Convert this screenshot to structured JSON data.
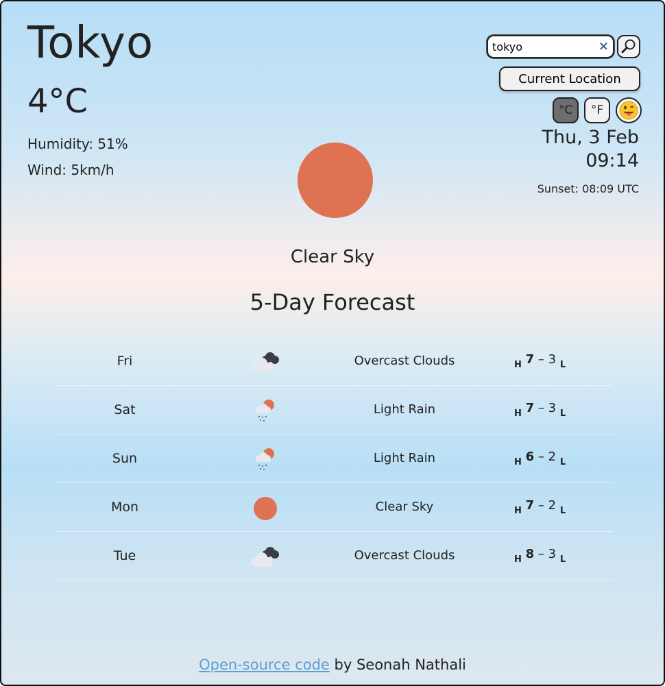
{
  "current": {
    "city": "Tokyo",
    "temperature": "4°C",
    "humidity": "Humidity: 51%",
    "wind": "Wind: 5km/h",
    "condition": "Clear Sky",
    "condition_icon": "sun-icon"
  },
  "search": {
    "value": "tokyo",
    "clear_icon": "×",
    "search_icon": "magnifier-icon",
    "location_button": "Current Location"
  },
  "units": {
    "celsius": "°C",
    "fahrenheit": "°F",
    "active": "celsius",
    "theme_icon": "tongue-face-emoji-icon"
  },
  "datetime": {
    "date": "Thu, 3 Feb",
    "time": "09:14",
    "sunset": "Sunset: 08:09 UTC"
  },
  "forecast": {
    "title": "5-Day Forecast",
    "high_label": "H",
    "low_label": "L",
    "separator": "–",
    "days": [
      {
        "day": "Fri",
        "icon": "overcast-clouds-icon",
        "desc": "Overcast Clouds",
        "high": "7",
        "low": "3"
      },
      {
        "day": "Sat",
        "icon": "light-rain-icon",
        "desc": "Light Rain",
        "high": "7",
        "low": "3"
      },
      {
        "day": "Sun",
        "icon": "light-rain-icon",
        "desc": "Light Rain",
        "high": "6",
        "low": "2"
      },
      {
        "day": "Mon",
        "icon": "clear-sky-icon",
        "desc": "Clear Sky",
        "high": "7",
        "low": "2"
      },
      {
        "day": "Tue",
        "icon": "overcast-clouds-icon",
        "desc": "Overcast Clouds",
        "high": "8",
        "low": "3"
      }
    ]
  },
  "footer": {
    "link_text": "Open-source code",
    "suffix": " by Seonah Nathali"
  },
  "colors": {
    "sun": "#df7252",
    "link": "#5f9fd2",
    "active_unit_bg": "#6d6d6d"
  }
}
